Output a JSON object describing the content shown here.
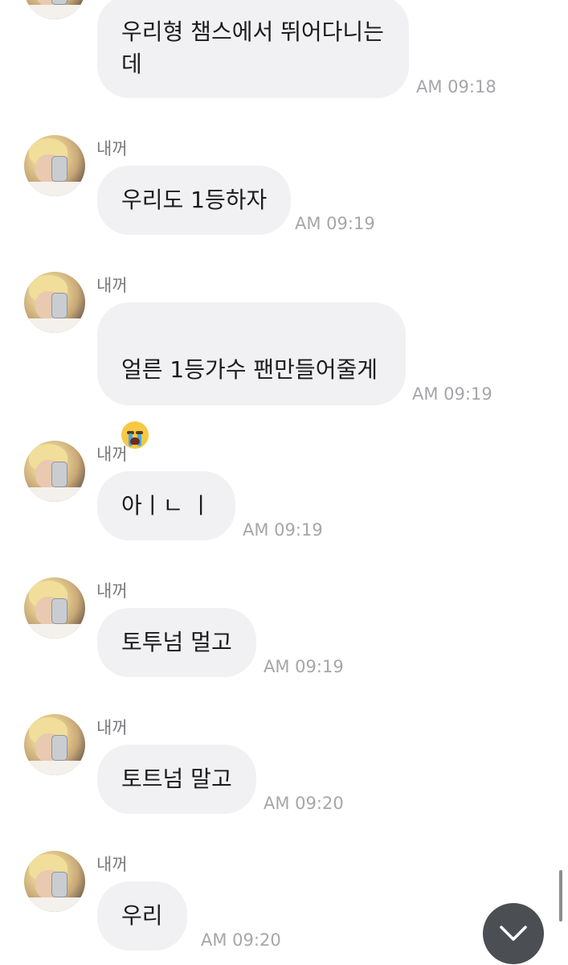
{
  "messages": [
    {
      "sender": "",
      "text": "우리형 챔스에서 뛰어다니는\n데",
      "time": "AM 09:18",
      "show_avatar": false
    },
    {
      "sender": "내꺼",
      "text": "우리도 1등하자",
      "time": "AM 09:19",
      "show_avatar": true
    },
    {
      "sender": "내꺼",
      "text": "얼른 1등가수 팬만들어줄게",
      "emoji": "loudly-crying-face",
      "time": "AM 09:19",
      "show_avatar": true
    },
    {
      "sender": "내꺼",
      "text": "아ㅣㄴ ㅣ",
      "time": "AM 09:19",
      "show_avatar": true
    },
    {
      "sender": "내꺼",
      "text": "토투넘 멀고",
      "time": "AM 09:19",
      "show_avatar": true
    },
    {
      "sender": "내꺼",
      "text": "토트넘 말고",
      "time": "AM 09:20",
      "show_avatar": true
    },
    {
      "sender": "내꺼",
      "text": "우리",
      "time": "AM 09:20",
      "show_avatar": true
    }
  ],
  "controls": {
    "scroll_down_icon": "chevron-down-icon"
  },
  "colors": {
    "bubble_bg": "#f1f1f3",
    "time_text": "#a6a6ab",
    "name_text": "#7a7a7f",
    "scroll_button_bg": "#4b4e53"
  }
}
